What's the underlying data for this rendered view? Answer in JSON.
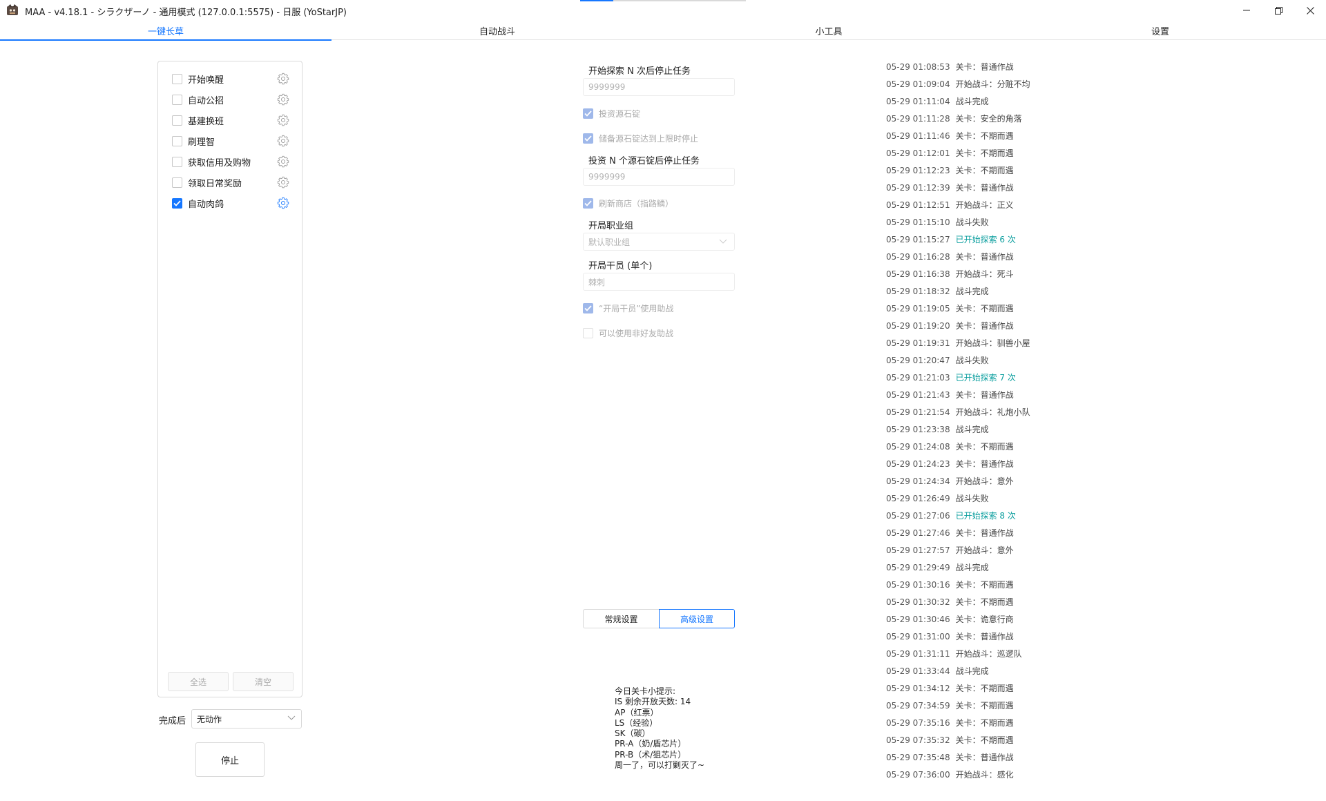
{
  "window": {
    "title": "MAA - v4.18.1 - シラクザーノ - 通用模式 (127.0.0.1:5575) - 日服 (YoStarJP)",
    "progress": 0.2
  },
  "tabs": [
    {
      "label": "一键长草",
      "active": true
    },
    {
      "label": "自动战斗",
      "active": false
    },
    {
      "label": "小工具",
      "active": false
    },
    {
      "label": "设置",
      "active": false
    }
  ],
  "tasks": [
    {
      "label": "开始唤醒",
      "checked": false
    },
    {
      "label": "自动公招",
      "checked": false
    },
    {
      "label": "基建换班",
      "checked": false
    },
    {
      "label": "刷理智",
      "checked": false
    },
    {
      "label": "获取信用及购物",
      "checked": false
    },
    {
      "label": "领取日常奖励",
      "checked": false
    },
    {
      "label": "自动肉鸽",
      "checked": true
    }
  ],
  "task_panel": {
    "select_all_label": "全选",
    "clear_label": "清空",
    "after_label": "完成后",
    "after_value": "无动作",
    "stop_label": "停止"
  },
  "settings": {
    "explore_label": "开始探索 N 次后停止任务",
    "explore_value": "9999999",
    "invest_label": "投资源石锭",
    "invest_checked": true,
    "invest_stop_full_label": "储备源石锭达到上限时停止",
    "invest_stop_full_checked": true,
    "invest_n_label": "投资 N 个源石锭后停止任务",
    "invest_n_value": "9999999",
    "refresh_shop_label": "刷新商店（指路鳞）",
    "refresh_shop_checked": true,
    "squad_label": "开局职业组",
    "squad_value": "默认职业组",
    "starter_label": "开局干员 (单个)",
    "starter_value": "棘刺",
    "starter_support_label": "“开局干员”使用助战",
    "starter_support_checked": true,
    "non_friend_label": "可以使用非好友助战",
    "non_friend_checked": false,
    "seg_normal": "常规设置",
    "seg_advanced": "高级设置"
  },
  "tips": [
    "今日关卡小提示:",
    "IS 剩余开放天数: 14",
    "AP（红票）",
    "LS（经验）",
    "SK（碳）",
    "PR-A（奶/盾芯片）",
    "PR-B（术/狙芯片）",
    "周一了，可以打剿灭了~"
  ],
  "log": [
    {
      "time": "05-29  01:08:53",
      "msg": "关卡：普通作战",
      "hl": false
    },
    {
      "time": "05-29  01:09:04",
      "msg": "开始战斗：分赃不均",
      "hl": false
    },
    {
      "time": "05-29  01:11:04",
      "msg": "战斗完成",
      "hl": false
    },
    {
      "time": "05-29  01:11:28",
      "msg": "关卡：安全的角落",
      "hl": false
    },
    {
      "time": "05-29  01:11:46",
      "msg": "关卡：不期而遇",
      "hl": false
    },
    {
      "time": "05-29  01:12:01",
      "msg": "关卡：不期而遇",
      "hl": false
    },
    {
      "time": "05-29  01:12:23",
      "msg": "关卡：不期而遇",
      "hl": false
    },
    {
      "time": "05-29  01:12:39",
      "msg": "关卡：普通作战",
      "hl": false
    },
    {
      "time": "05-29  01:12:51",
      "msg": "开始战斗：正义",
      "hl": false
    },
    {
      "time": "05-29  01:15:10",
      "msg": "战斗失败",
      "hl": false
    },
    {
      "time": "05-29  01:15:27",
      "msg": "已开始探索 6 次",
      "hl": true
    },
    {
      "time": "05-29  01:16:28",
      "msg": "关卡：普通作战",
      "hl": false
    },
    {
      "time": "05-29  01:16:38",
      "msg": "开始战斗：死斗",
      "hl": false
    },
    {
      "time": "05-29  01:18:32",
      "msg": "战斗完成",
      "hl": false
    },
    {
      "time": "05-29  01:19:05",
      "msg": "关卡：不期而遇",
      "hl": false
    },
    {
      "time": "05-29  01:19:20",
      "msg": "关卡：普通作战",
      "hl": false
    },
    {
      "time": "05-29  01:19:31",
      "msg": "开始战斗：驯兽小屋",
      "hl": false
    },
    {
      "time": "05-29  01:20:47",
      "msg": "战斗失败",
      "hl": false
    },
    {
      "time": "05-29  01:21:03",
      "msg": "已开始探索 7 次",
      "hl": true
    },
    {
      "time": "05-29  01:21:43",
      "msg": "关卡：普通作战",
      "hl": false
    },
    {
      "time": "05-29  01:21:54",
      "msg": "开始战斗：礼炮小队",
      "hl": false
    },
    {
      "time": "05-29  01:23:38",
      "msg": "战斗完成",
      "hl": false
    },
    {
      "time": "05-29  01:24:08",
      "msg": "关卡：不期而遇",
      "hl": false
    },
    {
      "time": "05-29  01:24:23",
      "msg": "关卡：普通作战",
      "hl": false
    },
    {
      "time": "05-29  01:24:34",
      "msg": "开始战斗：意外",
      "hl": false
    },
    {
      "time": "05-29  01:26:49",
      "msg": "战斗失败",
      "hl": false
    },
    {
      "time": "05-29  01:27:06",
      "msg": "已开始探索 8 次",
      "hl": true
    },
    {
      "time": "05-29  01:27:46",
      "msg": "关卡：普通作战",
      "hl": false
    },
    {
      "time": "05-29  01:27:57",
      "msg": "开始战斗：意外",
      "hl": false
    },
    {
      "time": "05-29  01:29:49",
      "msg": "战斗完成",
      "hl": false
    },
    {
      "time": "05-29  01:30:16",
      "msg": "关卡：不期而遇",
      "hl": false
    },
    {
      "time": "05-29  01:30:32",
      "msg": "关卡：不期而遇",
      "hl": false
    },
    {
      "time": "05-29  01:30:46",
      "msg": "关卡：诡意行商",
      "hl": false
    },
    {
      "time": "05-29  01:31:00",
      "msg": "关卡：普通作战",
      "hl": false
    },
    {
      "time": "05-29  01:31:11",
      "msg": "开始战斗：巡逻队",
      "hl": false
    },
    {
      "time": "05-29  01:33:44",
      "msg": "战斗完成",
      "hl": false
    },
    {
      "time": "05-29  01:34:12",
      "msg": "关卡：不期而遇",
      "hl": false
    },
    {
      "time": "05-29  07:34:59",
      "msg": "关卡：不期而遇",
      "hl": false
    },
    {
      "time": "05-29  07:35:16",
      "msg": "关卡：不期而遇",
      "hl": false
    },
    {
      "time": "05-29  07:35:32",
      "msg": "关卡：不期而遇",
      "hl": false
    },
    {
      "time": "05-29  07:35:48",
      "msg": "关卡：普通作战",
      "hl": false
    },
    {
      "time": "05-29  07:36:00",
      "msg": "开始战斗：感化",
      "hl": false
    }
  ],
  "colors": {
    "accent": "#1677ff",
    "log_highlight": "#0a9e9e"
  }
}
